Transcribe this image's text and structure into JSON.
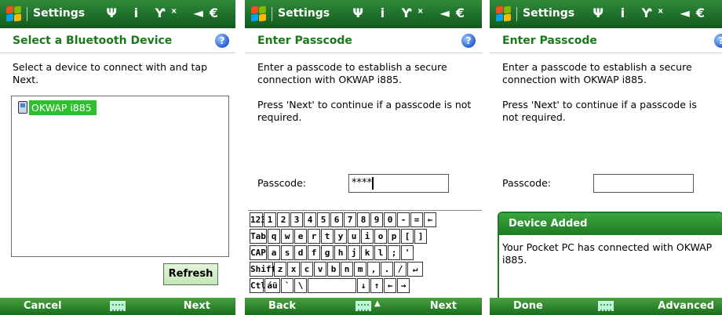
{
  "status_bar": {
    "title": "Settings",
    "icons": "Ψ i Ƴˣ ◄€"
  },
  "screens": {
    "select": {
      "header": "Select a Bluetooth Device",
      "instruction": "Select a device to connect with and tap Next.",
      "devices": [
        "OKWAP i885"
      ],
      "refresh_label": "Refresh",
      "softkeys": {
        "left": "Cancel",
        "right": "Next"
      }
    },
    "passcode_entry": {
      "header": "Enter Passcode",
      "intro": "Enter a passcode to establish a secure connection with OKWAP i885.",
      "hint": "Press 'Next' to continue if a passcode is not required.",
      "passcode_label": "Passcode:",
      "passcode_value": "****",
      "softkeys": {
        "left": "Back",
        "right": "Next"
      },
      "keyboard_rows": [
        [
          "123",
          "1",
          "2",
          "3",
          "4",
          "5",
          "6",
          "7",
          "8",
          "9",
          "0",
          "-",
          "=",
          "←"
        ],
        [
          "Tab",
          "q",
          "w",
          "e",
          "r",
          "t",
          "y",
          "u",
          "i",
          "o",
          "p",
          "[",
          "]"
        ],
        [
          "CAP",
          "a",
          "s",
          "d",
          "f",
          "g",
          "h",
          "j",
          "k",
          "l",
          ";",
          "'"
        ],
        [
          "Shift",
          "z",
          "x",
          "c",
          "v",
          "b",
          "n",
          "m",
          ",",
          ".",
          "/",
          "↵"
        ],
        [
          "Ctl",
          "áü",
          "`",
          "\\",
          "",
          "↓",
          "↑",
          "←",
          "→"
        ]
      ]
    },
    "device_added": {
      "header": "Enter Passcode",
      "intro": "Enter a passcode to establish a secure connection with OKWAP i885.",
      "hint": "Press 'Next' to continue if a passcode is not required.",
      "passcode_label": "Passcode:",
      "passcode_value": "",
      "dialog_title": "Device Added",
      "dialog_message": "Your Pocket PC has connected with OKWAP i885.",
      "softkeys": {
        "left": "Done",
        "right": "Advanced"
      }
    }
  },
  "colors": {
    "brand_green": "#1d7a22",
    "selection_green": "#2dbf2d",
    "help_blue": "#2a5fd1"
  }
}
